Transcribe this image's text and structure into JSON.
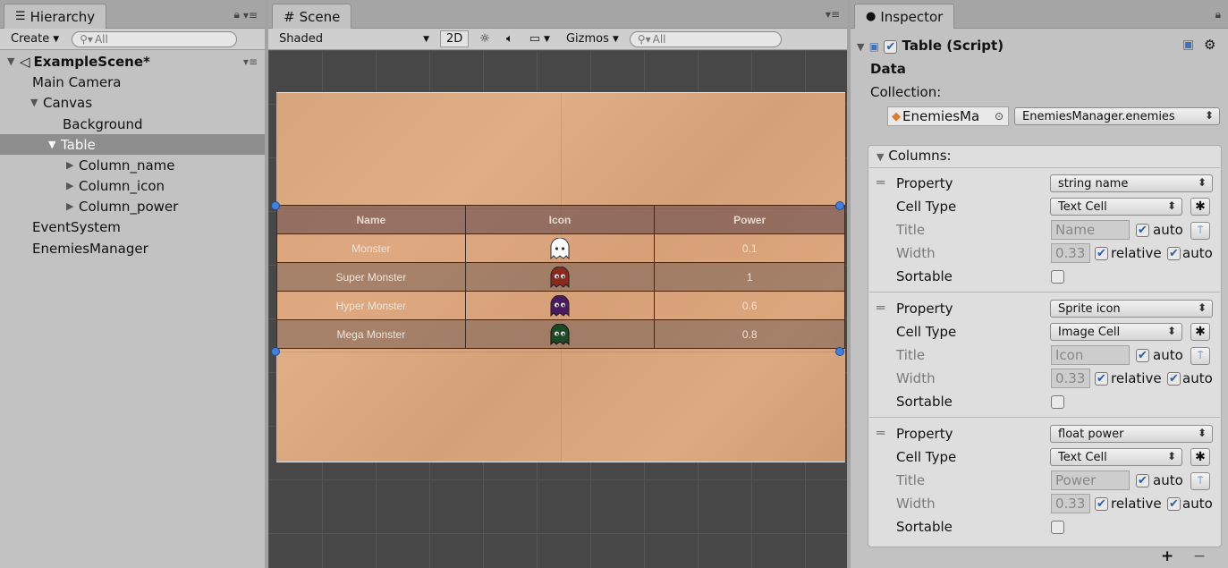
{
  "hierarchy": {
    "tab_label": "Hierarchy",
    "create_label": "Create",
    "search_placeholder": "All",
    "scene_name": "ExampleScene*",
    "items": [
      {
        "label": "Main Camera"
      },
      {
        "label": "Canvas"
      },
      {
        "label": "Background"
      },
      {
        "label": "Table"
      },
      {
        "label": "Column_name"
      },
      {
        "label": "Column_icon"
      },
      {
        "label": "Column_power"
      },
      {
        "label": "EventSystem"
      },
      {
        "label": "EnemiesManager"
      }
    ]
  },
  "scene": {
    "tab_label": "Scene",
    "shading_mode": "Shaded",
    "mode_2d": "2D",
    "gizmos_label": "Gizmos",
    "search_placeholder": "All",
    "table": {
      "headers": [
        "Name",
        "Icon",
        "Power"
      ],
      "rows": [
        {
          "name": "Monster",
          "power": "0.1",
          "icon_color": "#ffffff"
        },
        {
          "name": "Super Monster",
          "power": "1",
          "icon_color": "#8a2a1e"
        },
        {
          "name": "Hyper Monster",
          "power": "0.6",
          "icon_color": "#4a1a5e"
        },
        {
          "name": "Mega Monster",
          "power": "0.8",
          "icon_color": "#1c4a24"
        }
      ]
    }
  },
  "inspector": {
    "tab_label": "Inspector",
    "component_title": "Table (Script)",
    "data_label": "Data",
    "collection_label": "Collection:",
    "collection_object": "EnemiesMa",
    "collection_member": "EnemiesManager.enemies",
    "columns_label": "Columns:",
    "labels": {
      "property": "Property",
      "cell_type": "Cell Type",
      "title": "Title",
      "width": "Width",
      "sortable": "Sortable",
      "auto": "auto",
      "relative": "relative"
    },
    "columns": [
      {
        "property": "string name",
        "cell_type": "Text Cell",
        "title": "Name",
        "width": "0.33"
      },
      {
        "property": "Sprite icon",
        "cell_type": "Image Cell",
        "title": "Icon",
        "width": "0.33"
      },
      {
        "property": "float power",
        "cell_type": "Text Cell",
        "title": "Power",
        "width": "0.33"
      }
    ],
    "add_label": "+",
    "remove_label": "−"
  }
}
